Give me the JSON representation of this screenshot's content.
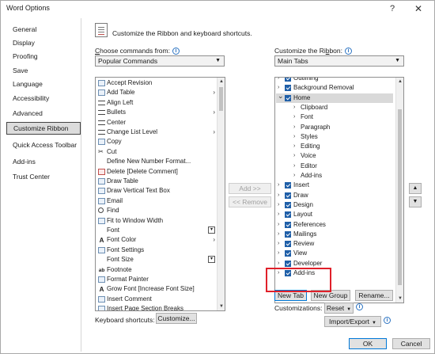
{
  "window": {
    "title": "Word Options",
    "help": "?",
    "close": "✕"
  },
  "nav": [
    {
      "label": "General",
      "selected": false
    },
    {
      "label": "Display",
      "selected": false
    },
    {
      "label": "Proofing",
      "selected": false
    },
    {
      "label": "Save",
      "selected": false
    },
    {
      "label": "Language",
      "selected": false
    },
    {
      "label": "Accessibility",
      "selected": false
    },
    {
      "label": "Advanced",
      "selected": false
    },
    {
      "label": "Customize Ribbon",
      "selected": true
    },
    {
      "label": "Quick Access Toolbar",
      "selected": false
    },
    {
      "label": "Add-ins",
      "selected": false
    },
    {
      "label": "Trust Center",
      "selected": false
    }
  ],
  "header": {
    "text": "Customize the Ribbon and keyboard shortcuts.",
    "icon": "customize-ribbon-icon"
  },
  "choose": {
    "label_pre": "",
    "label_u": "C",
    "label_post": "hoose commands from:",
    "value": "Popular Commands"
  },
  "customize": {
    "label_pre": "Customize the Ri",
    "label_u": "b",
    "label_post": "bon:",
    "value": "Main Tabs"
  },
  "info_glyph": "i",
  "commands": [
    {
      "label": "Accept Revision",
      "icon": "accept-revision-icon",
      "kind": "gen",
      "suffix": ""
    },
    {
      "label": "Add Table",
      "icon": "table-icon",
      "kind": "gen",
      "suffix": "arrow"
    },
    {
      "label": "Align Left",
      "icon": "align-left-icon",
      "kind": "line",
      "suffix": ""
    },
    {
      "label": "Bullets",
      "icon": "bullets-icon",
      "kind": "line",
      "suffix": "arrow"
    },
    {
      "label": "Center",
      "icon": "center-icon",
      "kind": "line",
      "suffix": ""
    },
    {
      "label": "Change List Level",
      "icon": "list-level-icon",
      "kind": "line",
      "suffix": "arrow"
    },
    {
      "label": "Copy",
      "icon": "copy-icon",
      "kind": "gen",
      "suffix": ""
    },
    {
      "label": "Cut",
      "icon": "cut-icon",
      "kind": "none",
      "suffix": ""
    },
    {
      "label": "Define New Number Format...",
      "icon": "",
      "kind": "none",
      "suffix": ""
    },
    {
      "label": "Delete [Delete Comment]",
      "icon": "delete-comment-icon",
      "kind": "red",
      "suffix": ""
    },
    {
      "label": "Draw Table",
      "icon": "draw-table-icon",
      "kind": "gen",
      "suffix": ""
    },
    {
      "label": "Draw Vertical Text Box",
      "icon": "text-box-icon",
      "kind": "gen",
      "suffix": ""
    },
    {
      "label": "Email",
      "icon": "email-icon",
      "kind": "gen",
      "suffix": ""
    },
    {
      "label": "Find",
      "icon": "find-icon",
      "kind": "dot",
      "suffix": ""
    },
    {
      "label": "Fit to Window Width",
      "icon": "fit-width-icon",
      "kind": "gen",
      "suffix": ""
    },
    {
      "label": "Font",
      "icon": "",
      "kind": "none",
      "suffix": "box"
    },
    {
      "label": "Font Color",
      "icon": "font-color-icon",
      "kind": "charA",
      "suffix": "arrow"
    },
    {
      "label": "Font Settings",
      "icon": "font-settings-icon",
      "kind": "gen",
      "suffix": ""
    },
    {
      "label": "Font Size",
      "icon": "",
      "kind": "none",
      "suffix": "box"
    },
    {
      "label": "Footnote",
      "icon": "footnote-icon",
      "kind": "charab",
      "suffix": ""
    },
    {
      "label": "Format Painter",
      "icon": "format-painter-icon",
      "kind": "gen",
      "suffix": ""
    },
    {
      "label": "Grow Font [Increase Font Size]",
      "icon": "grow-font-icon",
      "kind": "charA",
      "suffix": ""
    },
    {
      "label": "Insert Comment",
      "icon": "insert-comment-icon",
      "kind": "gen",
      "suffix": ""
    },
    {
      "label": "Insert Page Section Breaks",
      "icon": "page-break-icon",
      "kind": "gen",
      "suffix": ""
    }
  ],
  "tree": [
    {
      "label": "Outlining",
      "level": 0,
      "expand": ">",
      "check": true,
      "hl": false
    },
    {
      "label": "Background Removal",
      "level": 0,
      "expand": ">",
      "check": true,
      "hl": false
    },
    {
      "label": "Home",
      "level": 0,
      "expand": "v",
      "check": true,
      "hl": true
    },
    {
      "label": "Clipboard",
      "level": 1,
      "expand": ">",
      "check": false,
      "hl": false
    },
    {
      "label": "Font",
      "level": 1,
      "expand": ">",
      "check": false,
      "hl": false
    },
    {
      "label": "Paragraph",
      "level": 1,
      "expand": ">",
      "check": false,
      "hl": false
    },
    {
      "label": "Styles",
      "level": 1,
      "expand": ">",
      "check": false,
      "hl": false
    },
    {
      "label": "Editing",
      "level": 1,
      "expand": ">",
      "check": false,
      "hl": false
    },
    {
      "label": "Voice",
      "level": 1,
      "expand": ">",
      "check": false,
      "hl": false
    },
    {
      "label": "Editor",
      "level": 1,
      "expand": ">",
      "check": false,
      "hl": false
    },
    {
      "label": "Add-ins",
      "level": 1,
      "expand": ">",
      "check": false,
      "hl": false
    },
    {
      "label": "Insert",
      "level": 0,
      "expand": ">",
      "check": true,
      "hl": false
    },
    {
      "label": "Draw",
      "level": 0,
      "expand": ">",
      "check": true,
      "hl": false
    },
    {
      "label": "Design",
      "level": 0,
      "expand": ">",
      "check": true,
      "hl": false
    },
    {
      "label": "Layout",
      "level": 0,
      "expand": ">",
      "check": true,
      "hl": false
    },
    {
      "label": "References",
      "level": 0,
      "expand": ">",
      "check": true,
      "hl": false
    },
    {
      "label": "Mailings",
      "level": 0,
      "expand": ">",
      "check": true,
      "hl": false
    },
    {
      "label": "Review",
      "level": 0,
      "expand": ">",
      "check": true,
      "hl": false
    },
    {
      "label": "View",
      "level": 0,
      "expand": ">",
      "check": true,
      "hl": false
    },
    {
      "label": "Developer",
      "level": 0,
      "expand": ">",
      "check": true,
      "hl": false
    },
    {
      "label": "Add-ins",
      "level": 0,
      "expand": ">",
      "check": true,
      "hl": false
    }
  ],
  "buttons": {
    "add": "Add >>",
    "remove": "<< Remove",
    "new_tab": "New Tab",
    "new_group": "New Group",
    "rename": "Rename...",
    "reset": "Reset",
    "import_export": "Import/Export",
    "customize": "Customize...",
    "ok": "OK",
    "cancel": "Cancel",
    "move_up": "▲",
    "move_down": "▼"
  },
  "customizations_label": "Customizations:",
  "keyboard_label": "Keyboard shortcuts:",
  "highlight_color": "#e0202a",
  "accent": "#1f5fa8"
}
